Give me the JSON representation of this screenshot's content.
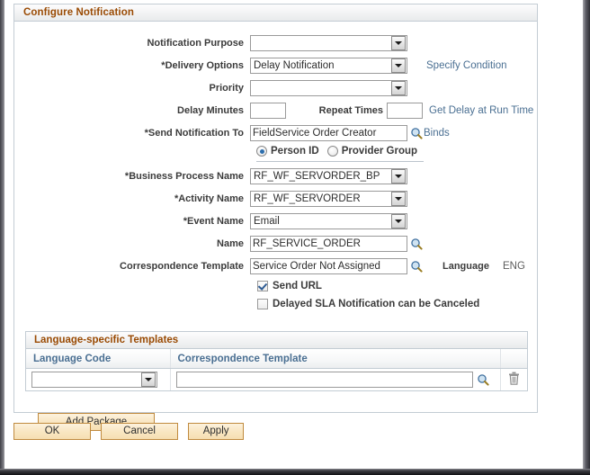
{
  "panel": {
    "title": "Configure Notification"
  },
  "form": {
    "notification_purpose": {
      "label": "Notification Purpose",
      "value": "",
      "type": "dropdown"
    },
    "delivery_options": {
      "label": "*Delivery Options",
      "value": "Delay Notification",
      "type": "dropdown",
      "link": "Specify Condition"
    },
    "priority": {
      "label": "Priority",
      "value": "",
      "type": "dropdown"
    },
    "delay_minutes": {
      "label": "Delay Minutes",
      "value": ""
    },
    "repeat_times": {
      "label": "Repeat Times",
      "value": "",
      "link": "Get Delay at Run Time"
    },
    "send_notification_to": {
      "label": "*Send Notification To",
      "value": "FieldService Order Creator",
      "lookup_icon": "magnifier-icon",
      "link": "Binds"
    },
    "recipient_type": {
      "options": [
        {
          "label": "Person ID",
          "selected": true
        },
        {
          "label": "Provider Group",
          "selected": false
        }
      ]
    },
    "business_process_name": {
      "label": "*Business Process Name",
      "value": "RF_WF_SERVORDER_BP",
      "type": "dropdown"
    },
    "activity_name": {
      "label": "*Activity Name",
      "value": "RF_WF_SERVORDER",
      "type": "dropdown"
    },
    "event_name": {
      "label": "*Event Name",
      "value": "Email",
      "type": "dropdown"
    },
    "name": {
      "label": "Name",
      "value": "RF_SERVICE_ORDER",
      "lookup_icon": "magnifier-icon"
    },
    "correspondence_template": {
      "label": "Correspondence Template",
      "value": "Service Order Not Assigned",
      "lookup_icon": "magnifier-icon"
    },
    "language": {
      "label": "Language",
      "value": "ENG"
    },
    "send_url": {
      "label": "Send URL",
      "checked": true
    },
    "delayed_sla": {
      "label": "Delayed SLA Notification can be Canceled",
      "checked": false
    }
  },
  "grid": {
    "title": "Language-specific Templates",
    "columns": [
      "Language Code",
      "Correspondence Template",
      ""
    ],
    "rows": [
      {
        "language_code": "",
        "correspondence_template": "",
        "lookup_icon": "magnifier-icon",
        "delete_icon": "trash-icon"
      }
    ],
    "add_button": "Add Package"
  },
  "footer": {
    "ok": "OK",
    "cancel": "Cancel",
    "apply": "Apply"
  },
  "colors": {
    "header_text": "#9a4b04",
    "link": "#4a6f92",
    "button_border": "#c08a3e",
    "panel_border": "#c3ccd4"
  }
}
